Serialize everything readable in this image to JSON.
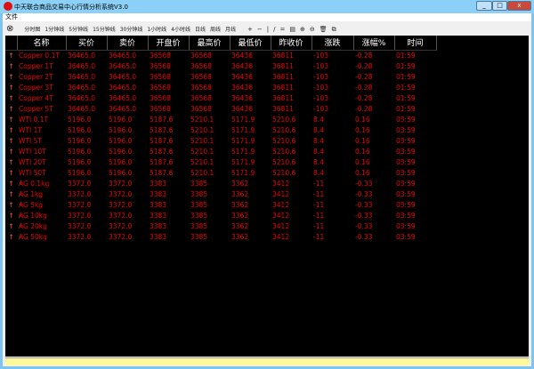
{
  "window": {
    "title": "中天联合商品交易中心行情分析系统V3.0",
    "minimize": "_",
    "maximize": "□",
    "close": "x"
  },
  "menu": [
    "文件"
  ],
  "toolbar": [
    "分时图",
    "1分钟线",
    "5分钟线",
    "15分钟线",
    "30分钟线",
    "1小时线",
    "4小时线",
    "日线",
    "周线",
    "月线"
  ],
  "tools": [
    "+",
    "−",
    "|",
    "/",
    "=",
    "▤",
    "⊕",
    "⊖",
    "🗑",
    "⧉"
  ],
  "columns": [
    "",
    "名称",
    "买价",
    "卖价",
    "开盘价",
    "最高价",
    "最低价",
    "昨收价",
    "涨跌",
    "涨幅%",
    "时间"
  ],
  "rows": [
    [
      "Copper 0.1T",
      "36465.0",
      "36465.0",
      "36568",
      "36568",
      "36436",
      "36811",
      "-103",
      "-0.28",
      "01:59"
    ],
    [
      "Copper 1T",
      "36465.0",
      "36465.0",
      "36568",
      "36568",
      "36436",
      "36811",
      "-103",
      "-0.28",
      "01:59"
    ],
    [
      "Copper 2T",
      "36465.0",
      "36465.0",
      "36568",
      "36568",
      "36436",
      "36811",
      "-103",
      "-0.28",
      "01:59"
    ],
    [
      "Copper 3T",
      "36465.0",
      "36465.0",
      "36568",
      "36568",
      "36436",
      "36811",
      "-103",
      "-0.28",
      "01:59"
    ],
    [
      "Copper 4T",
      "36465.0",
      "36465.0",
      "36568",
      "36568",
      "36436",
      "36811",
      "-103",
      "-0.28",
      "01:59"
    ],
    [
      "Copper 5T",
      "36465.0",
      "36465.0",
      "36568",
      "36568",
      "36436",
      "36811",
      "-103",
      "-0.28",
      "01:59"
    ],
    [
      "WTI 0.1T",
      "5196.0",
      "5196.0",
      "5187.6",
      "5210.1",
      "5171.9",
      "5210.6",
      "8.4",
      "0.16",
      "03:59"
    ],
    [
      "WTI 1T",
      "5196.0",
      "5196.0",
      "5187.6",
      "5210.1",
      "5171.9",
      "5210.6",
      "8.4",
      "0.16",
      "03:59"
    ],
    [
      "WTI 5T",
      "5196.0",
      "5196.0",
      "5187.6",
      "5210.1",
      "5171.9",
      "5210.6",
      "8.4",
      "0.16",
      "03:59"
    ],
    [
      "WTI 10T",
      "5196.0",
      "5196.0",
      "5187.6",
      "5210.1",
      "5171.9",
      "5210.6",
      "8.4",
      "0.16",
      "03:59"
    ],
    [
      "WTI 20T",
      "5196.0",
      "5196.0",
      "5187.6",
      "5210.1",
      "5171.9",
      "5210.6",
      "8.4",
      "0.16",
      "03:59"
    ],
    [
      "WTI 50T",
      "5196.0",
      "5196.0",
      "5187.6",
      "5210.1",
      "5171.9",
      "5210.6",
      "8.4",
      "0.16",
      "03:59"
    ],
    [
      "AG 0.1kg",
      "3372.0",
      "3372.0",
      "3383",
      "3385",
      "3362",
      "3412",
      "-11",
      "-0.33",
      "03:59"
    ],
    [
      "AG 1kg",
      "3372.0",
      "3372.0",
      "3383",
      "3385",
      "3362",
      "3412",
      "-11",
      "-0.33",
      "03:59"
    ],
    [
      "AG 5kg",
      "3372.0",
      "3372.0",
      "3383",
      "3385",
      "3362",
      "3412",
      "-11",
      "-0.33",
      "03:59"
    ],
    [
      "AG 10kg",
      "3372.0",
      "3372.0",
      "3383",
      "3385",
      "3362",
      "3412",
      "-11",
      "-0.33",
      "03:59"
    ],
    [
      "AG 20kg",
      "3372.0",
      "3372.0",
      "3383",
      "3385",
      "3362",
      "3412",
      "-11",
      "-0.33",
      "03:59"
    ],
    [
      "AG 50kg",
      "3372.0",
      "3372.0",
      "3383",
      "3385",
      "3362",
      "3412",
      "-11",
      "-0.33",
      "03:59"
    ]
  ],
  "row_icon": "arrow-up-icon",
  "colors": {
    "price": "#e00000",
    "background": "#000000",
    "status": "#fff99a"
  }
}
